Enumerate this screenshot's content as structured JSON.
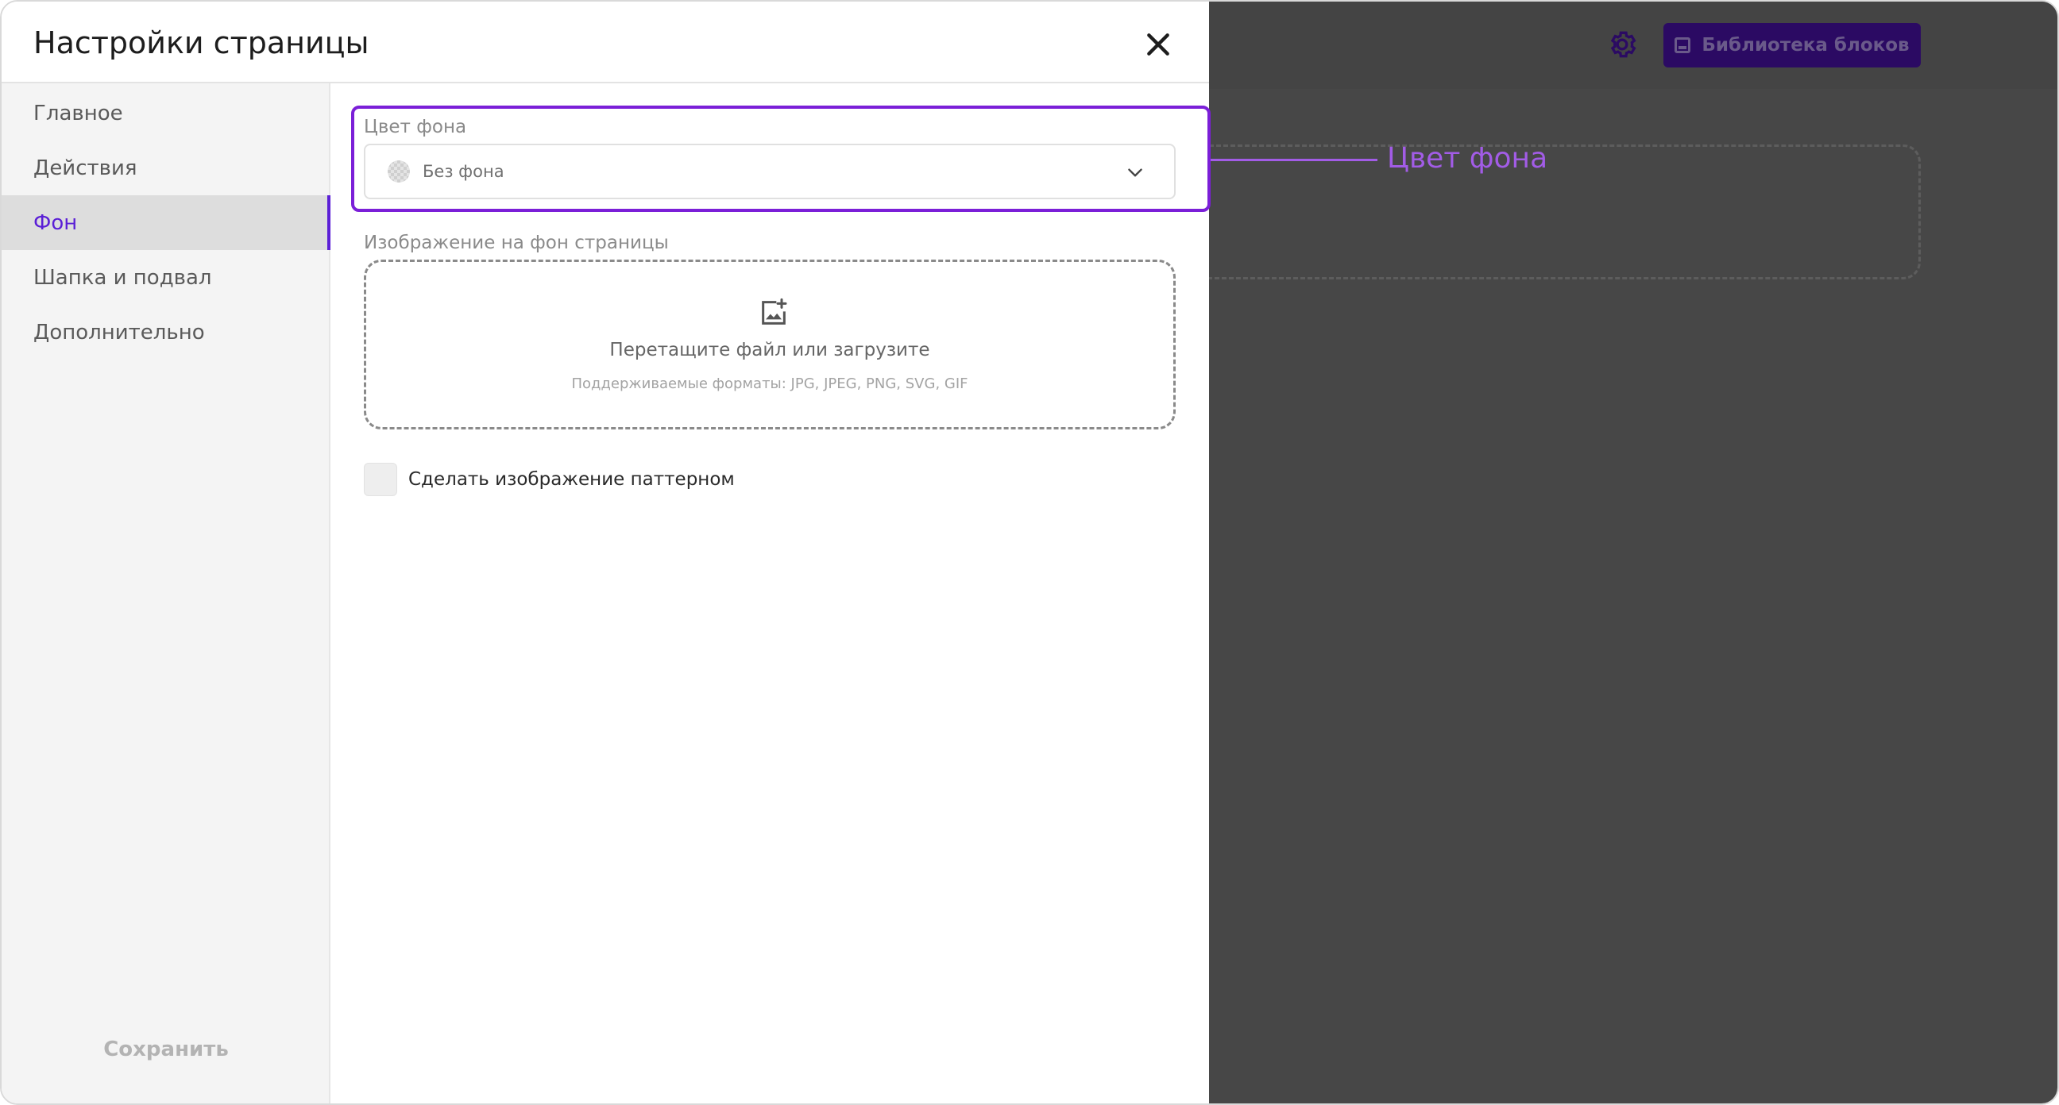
{
  "modal": {
    "title": "Настройки страницы",
    "nav": [
      {
        "label": "Главное"
      },
      {
        "label": "Действия"
      },
      {
        "label": "Фон",
        "active": true
      },
      {
        "label": "Шапка и подвал"
      },
      {
        "label": "Дополнительно"
      }
    ],
    "save_label": "Сохранить"
  },
  "background": {
    "color_label": "Цвет фона",
    "color_value": "Без фона",
    "image_label": "Изображение на фон страницы",
    "dropzone_text": "Перетащите файл или загрузите",
    "dropzone_formats": "Поддерживаемые форматы: JPG, JPEG, PNG, SVG, GIF",
    "pattern_checkbox_label": "Сделать изображение паттерном",
    "pattern_checked": false
  },
  "backdrop": {
    "library_button": "Библиотека блоков"
  },
  "annotation": {
    "label": "Цвет фона"
  },
  "icons": {
    "close": "close-icon",
    "chevron": "chevron-down-icon",
    "upload": "image-add-icon",
    "gear": "gear-icon",
    "library": "library-icon",
    "swatch": "transparent-swatch-icon"
  },
  "colors": {
    "accent": "#5b1fd6",
    "highlight": "#7b1fd8",
    "annotation": "#a25ce6",
    "library_button_bg": "#2b0a63",
    "backdrop": "#474747"
  }
}
